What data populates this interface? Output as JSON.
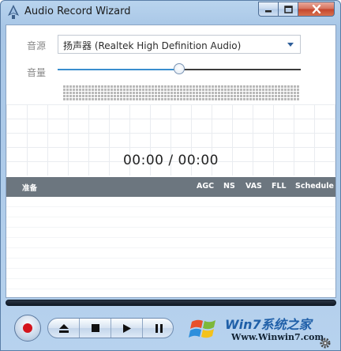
{
  "window": {
    "title": "Audio Record Wizard",
    "controls": {
      "minimize": "minimize-icon",
      "maximize": "maximize-icon",
      "close": "close-icon"
    }
  },
  "source": {
    "label": "音源",
    "selected": "扬声器 (Realtek High Definition Audio)"
  },
  "volume": {
    "label": "音量",
    "level": 0.5
  },
  "timer": {
    "display": "00:00 / 00:00"
  },
  "list": {
    "columns": [
      "准备",
      "AGC",
      "NS",
      "VAS",
      "FLL",
      "Schedule"
    ]
  },
  "transport": {
    "buttons": [
      "record-icon",
      "eject-icon",
      "stop-icon",
      "play-icon",
      "pause-icon",
      "gear-icon"
    ]
  },
  "watermark": {
    "brand": "Win7系统之家",
    "url": "Www.Winwin7.com"
  },
  "colors": {
    "header_bg": "#6c767f",
    "record_red": "#d4141c",
    "accent_blue": "#3a8ecf"
  }
}
